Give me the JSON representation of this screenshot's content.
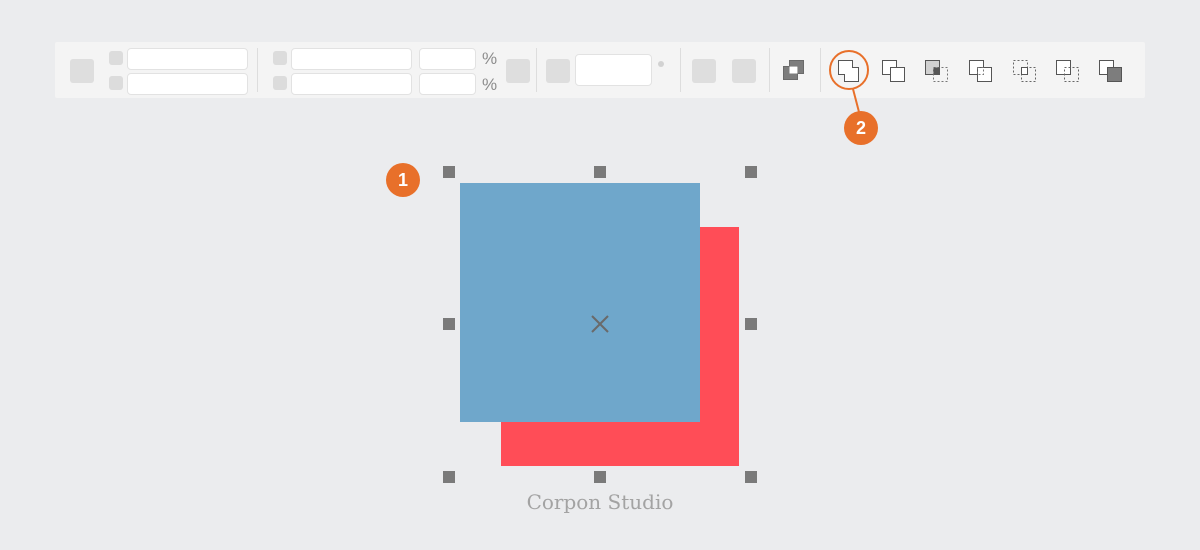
{
  "toolbar": {
    "percent_symbol": "%",
    "selected_tool": "shape-operation-1"
  },
  "callouts": [
    {
      "number": "1"
    },
    {
      "number": "2"
    }
  ],
  "canvas": {
    "shapes": [
      {
        "name": "front-square",
        "color": "#6fa7cb"
      },
      {
        "name": "back-square",
        "color": "#ff4d57"
      }
    ],
    "center_marker": "x-icon"
  },
  "watermark": "Corpon Studio",
  "colors": {
    "accent": "#e8702a",
    "handle": "#7a7a7a",
    "background": "#ebecee"
  }
}
